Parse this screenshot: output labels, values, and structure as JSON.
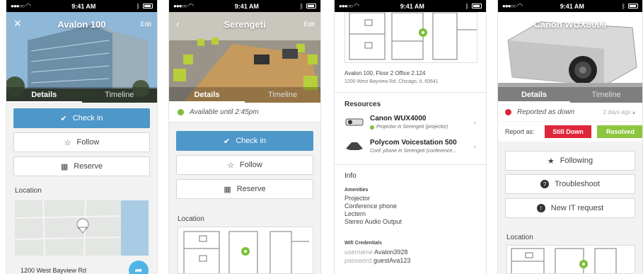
{
  "status_bar": {
    "carrier_dots": "●●●○○",
    "time": "9:41 AM"
  },
  "screen1": {
    "title": "Avalon 100",
    "edit_label": "Edit",
    "tabs": [
      "Details",
      "Timeline"
    ],
    "check_in_label": "Check in",
    "follow_label": "Follow",
    "reserve_label": "Reserve",
    "location_label": "Location",
    "address": "1200 West Bayview Rd"
  },
  "screen2": {
    "title": "Serengeti",
    "edit_label": "Edit",
    "tabs": [
      "Details",
      "Timeline"
    ],
    "availability": "Available until 2:45pm",
    "check_in_label": "Check in",
    "follow_label": "Follow",
    "reserve_label": "Reserve",
    "location_label": "Location"
  },
  "screen3": {
    "floor_line": "Avalon 100, Floor 2  Office 2.124",
    "address_line": "1200 West Bayview Rd. Chicago, IL 60641",
    "resources_label": "Resources",
    "resources": [
      {
        "name": "Canon WUX4000",
        "sub": "Projector in Serengeti (projector)"
      },
      {
        "name": "Polycom Voicestation 500",
        "sub": "Conf. phone in Serengeti (conference..."
      }
    ],
    "info_label": "Info",
    "amenities_label": "Amenities",
    "amenities": [
      "Projector",
      "Conference phone",
      "Lectern",
      "Stereo Audio Output"
    ],
    "wifi_label": "Wifi Credentials",
    "username_label": "username",
    "username_value": "Avalon3928",
    "password_label": "password",
    "password_value": "guestAva123"
  },
  "screen4": {
    "title": "Canon WUX8000",
    "tabs": [
      "Details",
      "Timeline"
    ],
    "reported_label": "Reported as down",
    "reported_time": "2 days ago",
    "report_as_label": "Report as:",
    "still_down_label": "Still Down",
    "resolved_label": "Resolved",
    "following_label": "Following",
    "troubleshoot_label": "Troubleshoot",
    "new_it_label": "New IT request",
    "location_label": "Location"
  },
  "colors": {
    "primary_blue": "#4d97c9",
    "available_green": "#7cbf3a",
    "down_red": "#e0263a",
    "resolved_green": "#8cc63f",
    "fab_blue": "#4fb4e6"
  }
}
